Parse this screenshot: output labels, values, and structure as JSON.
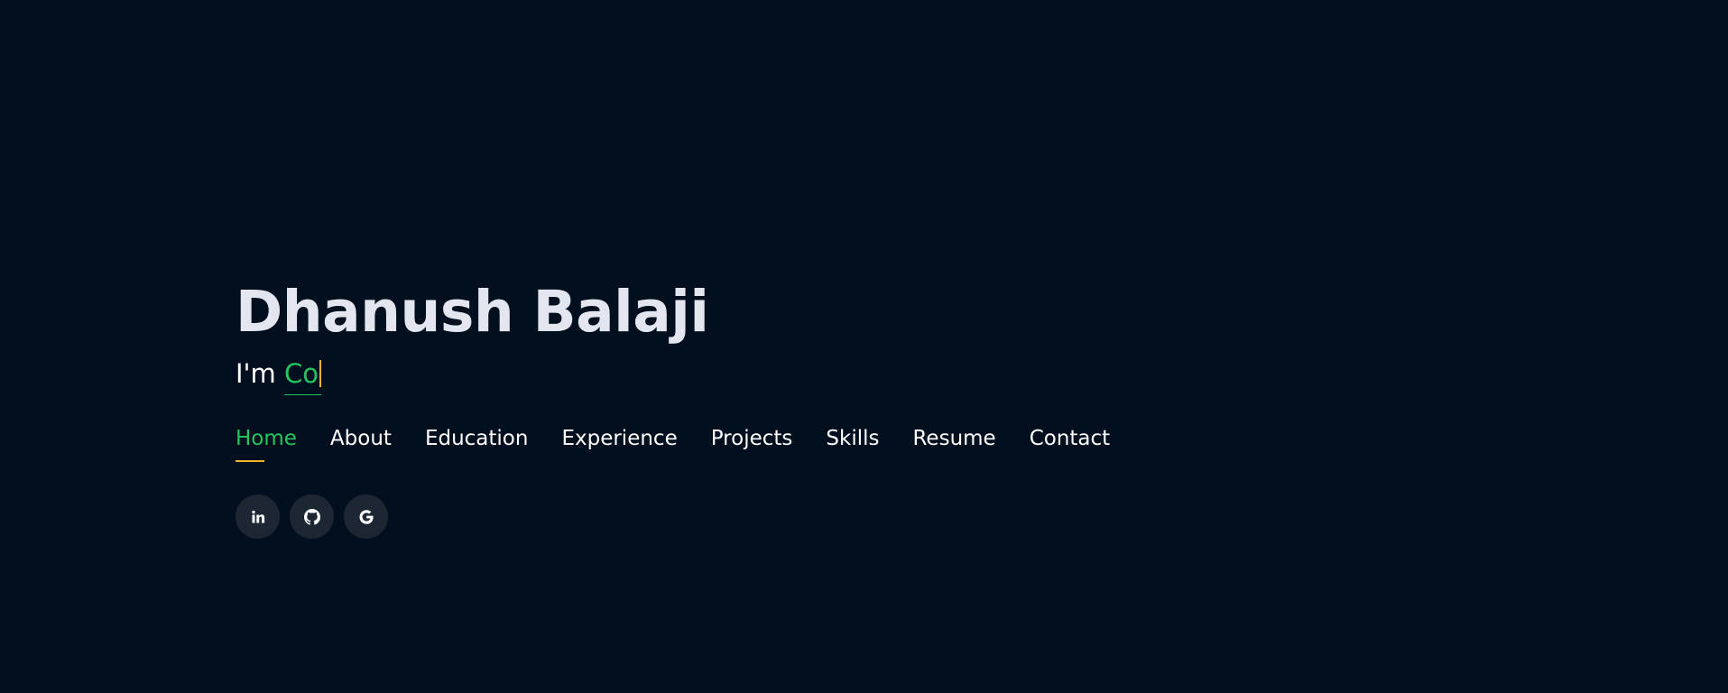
{
  "hero": {
    "name": "Dhanush Balaji",
    "intro_prefix": "I'm ",
    "typed_text": "Co"
  },
  "nav": {
    "items": [
      {
        "label": "Home",
        "active": true
      },
      {
        "label": "About"
      },
      {
        "label": "Education"
      },
      {
        "label": "Experience"
      },
      {
        "label": "Projects"
      },
      {
        "label": "Skills"
      },
      {
        "label": "Resume"
      },
      {
        "label": "Contact"
      }
    ]
  },
  "social": [
    {
      "icon": "linkedin-icon"
    },
    {
      "icon": "github-icon"
    },
    {
      "icon": "google-icon"
    }
  ],
  "colors": {
    "background": "#010f1e",
    "accent": "#22c55e",
    "cursor": "#f0b429",
    "social_bg": "#1d2734"
  }
}
